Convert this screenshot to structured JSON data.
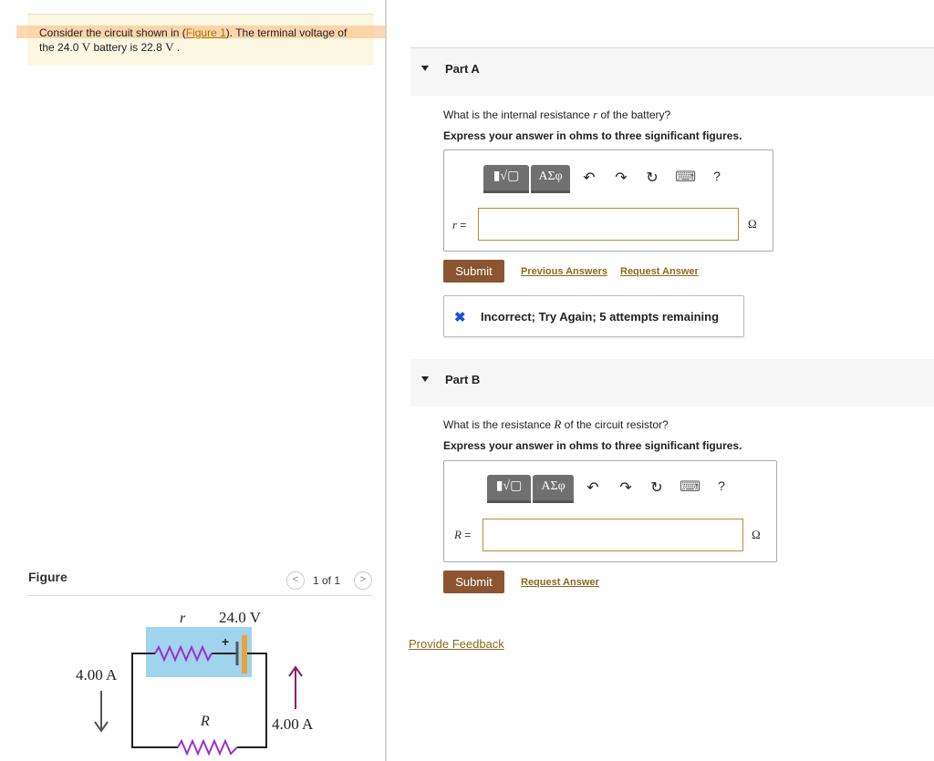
{
  "problem": {
    "text_before": "Consider the circuit shown in (",
    "figure_link": "Figure 1",
    "text_after": "). The terminal voltage of",
    "line2_prefix": "the 24.0 ",
    "line2_unit_v": "V",
    "line2_mid": " battery is 22.8 ",
    "line2_unit_v2": "V",
    "line2_end": " ."
  },
  "figure": {
    "label": "Figure",
    "pager": "1 of 1",
    "prev": "<",
    "next": ">",
    "circuit": {
      "r_label": "r",
      "battery_label": "24.0 V",
      "plus": "+",
      "R_label": "R",
      "left_current": "4.00 A",
      "right_current": "4.00 A"
    }
  },
  "parts": [
    {
      "title": "Part A",
      "question_prefix": "What is the internal resistance ",
      "question_var": "r",
      "question_suffix": " of the battery?",
      "instruction": "Express your answer in ohms to three significant figures.",
      "toolbar": {
        "templates": "▮√▢",
        "symbols": "ΑΣφ",
        "undo": "↶",
        "redo": "↷",
        "reset": "↻",
        "keyboard": "⌨",
        "help": "?"
      },
      "var_label": "r",
      "equals": " =",
      "unit": "Ω",
      "submit": "Submit",
      "prev_answers": "Previous Answers",
      "request_answer": "Request Answer",
      "feedback": {
        "icon": "✖",
        "text": "Incorrect; Try Again; 5 attempts remaining"
      }
    },
    {
      "title": "Part B",
      "question_prefix": "What is the resistance ",
      "question_var": "R",
      "question_suffix": " of the circuit resistor?",
      "instruction": "Express your answer in ohms to three significant figures.",
      "toolbar": {
        "templates": "▮√▢",
        "symbols": "ΑΣφ",
        "undo": "↶",
        "redo": "↷",
        "reset": "↻",
        "keyboard": "⌨",
        "help": "?"
      },
      "var_label": "R",
      "equals": " =",
      "unit": "Ω",
      "submit": "Submit",
      "request_answer": "Request Answer"
    }
  ],
  "provide_feedback": "Provide Feedback",
  "colors": {
    "highlight": "#f9c99a",
    "submit": "#8a5530",
    "link": "#8a6a1e",
    "error_icon": "#1e4fd1",
    "battery_box": "#9fd3ee",
    "resistor": "#9b30c9",
    "arrow_right": "#8a1f6b"
  }
}
